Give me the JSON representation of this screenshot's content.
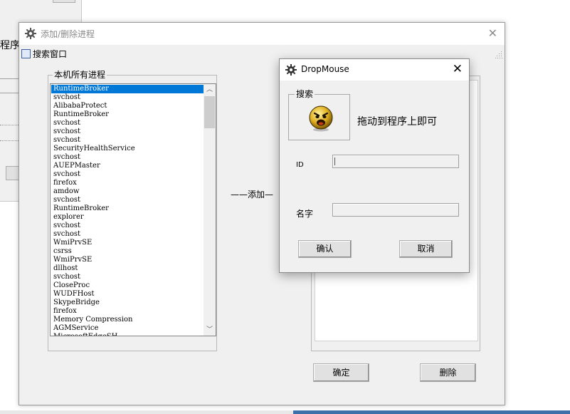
{
  "background_window": {
    "title_fragment": "程序"
  },
  "main_window": {
    "title": "添加/删除进程",
    "close_glyph": "✕",
    "search_window_label": "搜索窗口",
    "local_processes_legend": "本机所有进程",
    "add_label": "——添加—",
    "confirm_button": "确定",
    "delete_button": "删除",
    "processes": [
      "RuntimeBroker",
      "svchost",
      "AlibabaProtect",
      "RuntimeBroker",
      "svchost",
      "svchost",
      "svchost",
      "SecurityHealthService",
      "svchost",
      "AUEPMaster",
      "svchost",
      "firefox",
      "amdow",
      "svchost",
      "RuntimeBroker",
      "explorer",
      "svchost",
      "svchost",
      "WmiPrvSE",
      "csrss",
      "WmiPrvSE",
      "dllhost",
      "svchost",
      "CloseProc",
      "WUDFHost",
      "SkypeBridge",
      "firefox",
      "Memory Compression",
      "AGMService",
      "MicrosoftEdgeSH"
    ],
    "selected_index": 0,
    "scroll_up_glyph": "︿",
    "scroll_down_glyph": "﹀"
  },
  "dialog": {
    "title": "DropMouse",
    "close_glyph": "✕",
    "search_legend": "搜索",
    "hint": "拖动到程序上即可",
    "id_label": "ID",
    "name_label": "名字",
    "id_value": "",
    "name_value": "",
    "ok_button": "确认",
    "cancel_button": "取消"
  },
  "colors": {
    "selection": "#0078d7",
    "window_bg": "#f0f0f0",
    "taskbar_blue": "#3d6fa8"
  }
}
